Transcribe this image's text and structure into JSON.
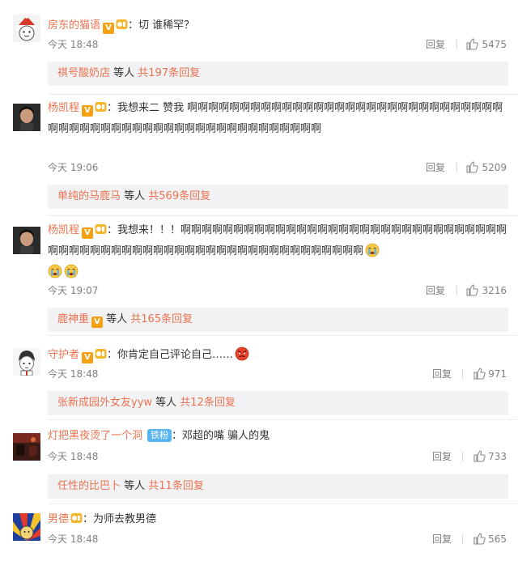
{
  "comments": [
    {
      "user": "房东的猫语",
      "text": "：切 谁稀罕？",
      "time": "今天 18:48",
      "reply_label": "回复",
      "likes": "5475",
      "sub": {
        "name": "祺号酸奶店",
        "mid": " 等人 ",
        "total": "共197条回复"
      }
    },
    {
      "user": "杨凯程",
      "text": "：我想来二   赞我 啊啊啊啊啊啊啊啊啊啊啊啊啊啊啊啊啊啊啊啊啊啊啊啊啊啊啊啊啊啊啊啊啊啊啊啊啊啊啊啊啊啊啊啊啊啊啊啊啊啊啊啊啊啊啊啊",
      "time": "今天 19:06",
      "reply_label": "回复",
      "likes": "5209",
      "sub": {
        "name": "单纯的马鹿马",
        "mid": " 等人 ",
        "total": "共569条回复"
      }
    },
    {
      "user": "杨凯程",
      "text": "：我想来！！！啊啊啊啊啊啊啊啊啊啊啊啊啊啊啊啊啊啊啊啊啊啊啊啊啊啊啊啊啊啊啊啊啊啊啊啊啊啊啊啊啊啊啊啊啊啊啊啊啊啊啊啊啊啊啊啊啊啊啊啊啊",
      "time": "今天 19:07",
      "reply_label": "回复",
      "likes": "3216",
      "sub": {
        "name": "鹿神重",
        "mid": " 等人 ",
        "total": "共165条回复"
      }
    },
    {
      "user": "守护者",
      "text": "：你肯定自己评论自己……",
      "time": "今天 18:48",
      "reply_label": "回复",
      "likes": "971",
      "sub": {
        "name": "张新成园外女友yyw",
        "mid": " 等人 ",
        "total": "共12条回复"
      }
    },
    {
      "user": "灯把黑夜烫了一个洞",
      "fan_badge": "铁粉",
      "text": "：邓超的嘴 骗人的鬼",
      "time": "今天 18:48",
      "reply_label": "回复",
      "likes": "733",
      "sub": {
        "name": "任性的比巴卜",
        "mid": " 等人 ",
        "total": "共11条回复"
      }
    },
    {
      "user": "男德",
      "text": "：为师去教男德",
      "time": "今天 18:48",
      "reply_label": "回复",
      "likes": "565"
    }
  ],
  "colors": {
    "username": "#eb7350",
    "meta": "#808080",
    "subbg": "#f2f2f5",
    "vbadge": "#f6a113",
    "fanbadge": "#59b4f0"
  }
}
